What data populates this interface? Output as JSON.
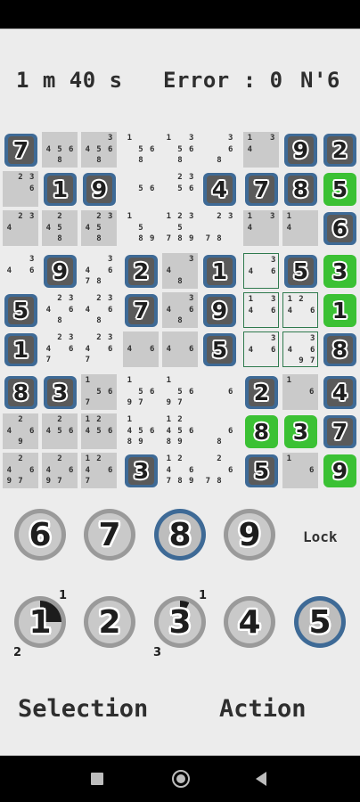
{
  "header": {
    "timer": "1 m 40 s",
    "errors": "Error : 0",
    "puzzle_number": "N'6"
  },
  "board": {
    "rows": [
      [
        {
          "style": "blue",
          "value": "7"
        },
        {
          "style": "gray",
          "notes": [
            "",
            "",
            "",
            "4",
            "5",
            "6",
            "",
            "8",
            ""
          ]
        },
        {
          "style": "gray",
          "notes": [
            "",
            "",
            "3",
            "4",
            "5",
            "6",
            "",
            "8",
            ""
          ]
        },
        {
          "style": "none",
          "notes": [
            "1",
            "",
            "",
            "",
            "5",
            "6",
            "",
            "8",
            ""
          ]
        },
        {
          "style": "none",
          "notes": [
            "1",
            "",
            "3",
            "",
            "5",
            "6",
            "",
            "8",
            ""
          ]
        },
        {
          "style": "none",
          "notes": [
            "",
            "",
            "3",
            "",
            "",
            "6",
            "",
            "8",
            ""
          ]
        },
        {
          "style": "gray",
          "notes": [
            "1",
            "",
            "3",
            "4",
            "",
            "",
            "",
            "",
            ""
          ]
        },
        {
          "style": "blue",
          "value": "9"
        },
        {
          "style": "blue",
          "value": "2"
        }
      ],
      [
        {
          "style": "gray",
          "notes": [
            "",
            "2",
            "3",
            "",
            "",
            "6",
            "",
            "",
            ""
          ]
        },
        {
          "style": "blue",
          "value": "1"
        },
        {
          "style": "blue",
          "value": "9"
        },
        {
          "style": "none",
          "notes": [
            "",
            "",
            "",
            "",
            "5",
            "6",
            "",
            "",
            ""
          ]
        },
        {
          "style": "none",
          "notes": [
            "",
            "2",
            "3",
            "",
            "5",
            "6",
            "",
            "",
            ""
          ]
        },
        {
          "style": "blue",
          "value": "4"
        },
        {
          "style": "blue",
          "value": "7"
        },
        {
          "style": "blue",
          "value": "8"
        },
        {
          "style": "green",
          "value": "5"
        }
      ],
      [
        {
          "style": "gray",
          "notes": [
            "",
            "2",
            "3",
            "4",
            "",
            "",
            "",
            "",
            ""
          ]
        },
        {
          "style": "gray",
          "notes": [
            "",
            "2",
            "",
            "4",
            "5",
            "",
            "",
            "8",
            ""
          ]
        },
        {
          "style": "gray",
          "notes": [
            "",
            "2",
            "3",
            "4",
            "5",
            "",
            "",
            "8",
            ""
          ]
        },
        {
          "style": "none",
          "notes": [
            "1",
            "",
            "",
            "",
            "5",
            "",
            "",
            "8",
            "9"
          ]
        },
        {
          "style": "none",
          "notes": [
            "1",
            "2",
            "3",
            "",
            "5",
            "",
            "7",
            "8",
            "9"
          ]
        },
        {
          "style": "none",
          "notes": [
            "",
            "2",
            "3",
            "",
            "",
            "",
            "7",
            "8",
            ""
          ]
        },
        {
          "style": "gray",
          "notes": [
            "1",
            "",
            "3",
            "4",
            "",
            "",
            "",
            "",
            ""
          ]
        },
        {
          "style": "gray",
          "notes": [
            "1",
            "",
            "",
            "4",
            "",
            "",
            "",
            "",
            ""
          ]
        },
        {
          "style": "blue",
          "value": "6"
        }
      ],
      [
        {
          "style": "none",
          "notes": [
            "",
            "",
            "3",
            "4",
            "",
            "6",
            "",
            "",
            ""
          ]
        },
        {
          "style": "blue",
          "value": "9"
        },
        {
          "style": "none",
          "notes": [
            "",
            "",
            "3",
            "4",
            "",
            "6",
            "7",
            "8",
            ""
          ]
        },
        {
          "style": "blue",
          "value": "2"
        },
        {
          "style": "gray",
          "notes": [
            "",
            "",
            "3",
            "4",
            "",
            "",
            "",
            "8",
            ""
          ]
        },
        {
          "style": "blue",
          "value": "1"
        },
        {
          "style": "outlined",
          "notes": [
            "",
            "",
            "3",
            "4",
            "",
            "6",
            "",
            "",
            ""
          ]
        },
        {
          "style": "blue",
          "value": "5"
        },
        {
          "style": "green",
          "value": "3"
        }
      ],
      [
        {
          "style": "blue",
          "value": "5"
        },
        {
          "style": "none",
          "notes": [
            "",
            "2",
            "3",
            "4",
            "",
            "6",
            "",
            "8",
            ""
          ]
        },
        {
          "style": "none",
          "notes": [
            "",
            "2",
            "3",
            "4",
            "",
            "6",
            "",
            "8",
            ""
          ]
        },
        {
          "style": "blue",
          "value": "7"
        },
        {
          "style": "gray",
          "notes": [
            "",
            "",
            "3",
            "4",
            "",
            "6",
            "",
            "8",
            ""
          ]
        },
        {
          "style": "blue",
          "value": "9"
        },
        {
          "style": "outlined",
          "notes": [
            "1",
            "",
            "3",
            "4",
            "",
            "6",
            "",
            "",
            ""
          ]
        },
        {
          "style": "outlined",
          "notes": [
            "1",
            "2",
            "",
            "4",
            "",
            "6",
            "",
            "",
            ""
          ]
        },
        {
          "style": "green",
          "value": "1"
        }
      ],
      [
        {
          "style": "blue",
          "value": "1"
        },
        {
          "style": "none",
          "notes": [
            "",
            "2",
            "3",
            "4",
            "",
            "6",
            "7",
            "",
            ""
          ]
        },
        {
          "style": "none",
          "notes": [
            "",
            "2",
            "3",
            "4",
            "",
            "6",
            "7",
            "",
            ""
          ]
        },
        {
          "style": "gray",
          "notes": [
            "",
            "",
            "",
            "4",
            "",
            "6",
            "",
            "",
            ""
          ]
        },
        {
          "style": "gray",
          "notes": [
            "",
            "",
            "",
            "4",
            "",
            "6",
            "",
            "",
            ""
          ]
        },
        {
          "style": "blue",
          "value": "5"
        },
        {
          "style": "outlined",
          "notes": [
            "",
            "",
            "3",
            "4",
            "",
            "6",
            "",
            "",
            ""
          ]
        },
        {
          "style": "outlined",
          "notes": [
            "",
            "",
            "3",
            "4",
            "",
            "6",
            "",
            "9",
            "7"
          ]
        },
        {
          "style": "blue",
          "value": "8"
        }
      ],
      [
        {
          "style": "blue",
          "value": "8"
        },
        {
          "style": "blue",
          "value": "3"
        },
        {
          "style": "gray",
          "notes": [
            "1",
            "",
            "",
            "",
            "5",
            "6",
            "7",
            "",
            ""
          ]
        },
        {
          "style": "none",
          "notes": [
            "1",
            "",
            "",
            "",
            "5",
            "6",
            "9",
            "7",
            ""
          ]
        },
        {
          "style": "none",
          "notes": [
            "1",
            "",
            "",
            "",
            "5",
            "6",
            "9",
            "7",
            ""
          ]
        },
        {
          "style": "none",
          "notes": [
            "",
            "",
            "",
            "",
            "",
            "6",
            "",
            "",
            ""
          ]
        },
        {
          "style": "blue",
          "value": "2"
        },
        {
          "style": "gray",
          "notes": [
            "1",
            "",
            "",
            "",
            "",
            "6",
            "",
            "",
            ""
          ]
        },
        {
          "style": "blue",
          "value": "4"
        }
      ],
      [
        {
          "style": "gray",
          "notes": [
            "",
            "2",
            "",
            "4",
            "",
            "6",
            "",
            "9",
            ""
          ]
        },
        {
          "style": "gray",
          "notes": [
            "",
            "2",
            "",
            "4",
            "5",
            "6",
            "",
            "",
            ""
          ]
        },
        {
          "style": "gray",
          "notes": [
            "1",
            "2",
            "",
            "4",
            "5",
            "6",
            "",
            "",
            ""
          ]
        },
        {
          "style": "none",
          "notes": [
            "1",
            "",
            "",
            "4",
            "5",
            "6",
            "8",
            "9",
            ""
          ]
        },
        {
          "style": "none",
          "notes": [
            "1",
            "2",
            "",
            "4",
            "5",
            "6",
            "8",
            "9",
            ""
          ]
        },
        {
          "style": "none",
          "notes": [
            "",
            "",
            "",
            "",
            "",
            "6",
            "",
            "8",
            ""
          ]
        },
        {
          "style": "green",
          "value": "8"
        },
        {
          "style": "green",
          "value": "3"
        },
        {
          "style": "blue",
          "value": "7"
        }
      ],
      [
        {
          "style": "gray",
          "notes": [
            "",
            "2",
            "",
            "4",
            "",
            "6",
            "9",
            "7",
            ""
          ]
        },
        {
          "style": "gray",
          "notes": [
            "",
            "2",
            "",
            "4",
            "",
            "6",
            "9",
            "7",
            ""
          ]
        },
        {
          "style": "gray",
          "notes": [
            "1",
            "2",
            "",
            "4",
            "",
            "6",
            "7",
            "",
            ""
          ]
        },
        {
          "style": "blue",
          "value": "3"
        },
        {
          "style": "none",
          "notes": [
            "1",
            "2",
            "",
            "4",
            "",
            "6",
            "7",
            "8",
            "9"
          ]
        },
        {
          "style": "none",
          "notes": [
            "",
            "2",
            "",
            "",
            "",
            "6",
            "7",
            "8",
            ""
          ]
        },
        {
          "style": "blue",
          "value": "5"
        },
        {
          "style": "gray",
          "notes": [
            "1",
            "",
            "",
            "",
            "",
            "6",
            "",
            "",
            ""
          ]
        },
        {
          "style": "green",
          "value": "9"
        }
      ]
    ]
  },
  "number_pad": {
    "top_row": [
      {
        "label": "6",
        "selected": false,
        "progress": "none"
      },
      {
        "label": "7",
        "selected": false,
        "progress": "none"
      },
      {
        "label": "8",
        "selected": true,
        "progress": "none"
      },
      {
        "label": "9",
        "selected": false,
        "progress": "none"
      }
    ],
    "bottom_row": [
      {
        "label": "1",
        "selected": false,
        "progress": "partial",
        "badge_top": "1",
        "badge_bottom": "2"
      },
      {
        "label": "2",
        "selected": false,
        "progress": "none",
        "badge_top": "",
        "badge_bottom": ""
      },
      {
        "label": "3",
        "selected": false,
        "progress": "small",
        "badge_top": "1",
        "badge_bottom": "3"
      },
      {
        "label": "4",
        "selected": false,
        "progress": "none",
        "badge_top": "",
        "badge_bottom": ""
      },
      {
        "label": "5",
        "selected": true,
        "progress": "none",
        "badge_top": "",
        "badge_bottom": ""
      }
    ],
    "lock_label": "Lock"
  },
  "footer": {
    "selection_label": "Selection",
    "action_label": "Action"
  },
  "colors": {
    "given_tile": "#3e6a96",
    "solved_tile": "#3bc134",
    "shaded_cell": "#cacaca",
    "highlight_outline": "#2f7a4e"
  },
  "icons": {
    "nav_recents": "square-icon",
    "nav_home": "circle-icon",
    "nav_back": "back-triangle-icon"
  }
}
